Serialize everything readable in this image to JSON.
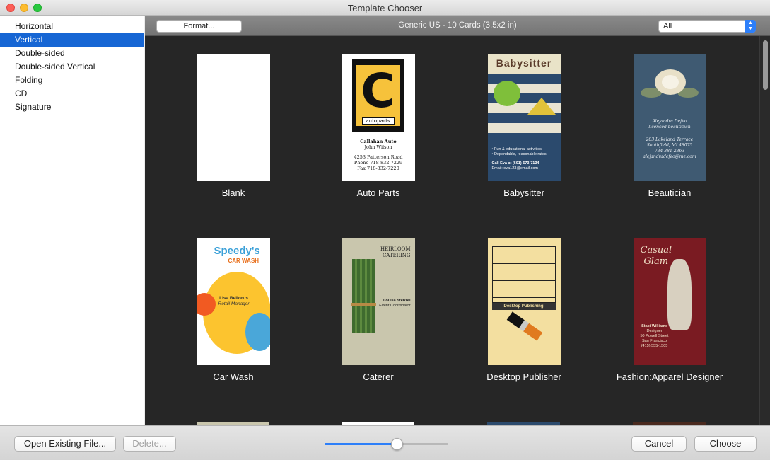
{
  "window": {
    "title": "Template Chooser"
  },
  "sidebar": {
    "items": [
      {
        "label": "Horizontal",
        "selected": false
      },
      {
        "label": "Vertical",
        "selected": true
      },
      {
        "label": "Double-sided",
        "selected": false
      },
      {
        "label": "Double-sided Vertical",
        "selected": false
      },
      {
        "label": "Folding",
        "selected": false
      },
      {
        "label": "CD",
        "selected": false
      },
      {
        "label": "Signature",
        "selected": false
      }
    ]
  },
  "toolbar": {
    "format_label": "Format...",
    "layout_label": "Generic US - 10 Cards (3.5x2 in)",
    "filter_value": "All"
  },
  "templates": [
    {
      "label": "Blank"
    },
    {
      "label": "Auto Parts",
      "art": {
        "letter": "C",
        "tag": "autoparts",
        "lines": [
          "Callahan Auto",
          "John Wilson",
          "",
          "4253 Patterson Road",
          "Phone 718-832-7229",
          "Fax 718-832-7220"
        ]
      }
    },
    {
      "label": "Babysitter",
      "art": {
        "heading": "Babysitter",
        "lines": [
          "• Fun & educational activities!",
          "• Dependable, reasonable rates.",
          "Call Eva at (601) 573-7134",
          "Email: eva123@email.com"
        ]
      }
    },
    {
      "label": "Beautician",
      "art": {
        "lines": [
          "Alejandra Defeo",
          "licenced beautician",
          "",
          "283 Lakeland Terrace",
          "Southfield, MI 48075",
          "734-381-2363",
          "alejandradefeo@me.com"
        ]
      }
    },
    {
      "label": "Car Wash",
      "art": {
        "logo": "Speedy's",
        "sub": "CAR WASH",
        "lines": [
          "Lisa Bellorus",
          "Retail Manager"
        ]
      }
    },
    {
      "label": "Caterer",
      "art": {
        "heading": [
          "HEIRLOOM",
          "CATERING"
        ],
        "lines": [
          "Louisa Stenzel",
          "Event Coordinator"
        ]
      }
    },
    {
      "label": "Desktop Publisher",
      "art": {
        "bar": "Desktop Publishing"
      }
    },
    {
      "label": "Fashion:Apparel Designer",
      "art": {
        "heading": [
          "Casual",
          "Glam"
        ],
        "lines": [
          "Staci Williams",
          "Designer",
          "50 Powell Street",
          "San Francisco",
          "(415) 555-1505"
        ]
      }
    }
  ],
  "footer": {
    "open_label": "Open Existing File...",
    "delete_label": "Delete...",
    "cancel_label": "Cancel",
    "choose_label": "Choose",
    "zoom_slider_value": 0.58
  },
  "colors": {
    "accent": "#1766d4",
    "grid_bg": "#262626"
  }
}
